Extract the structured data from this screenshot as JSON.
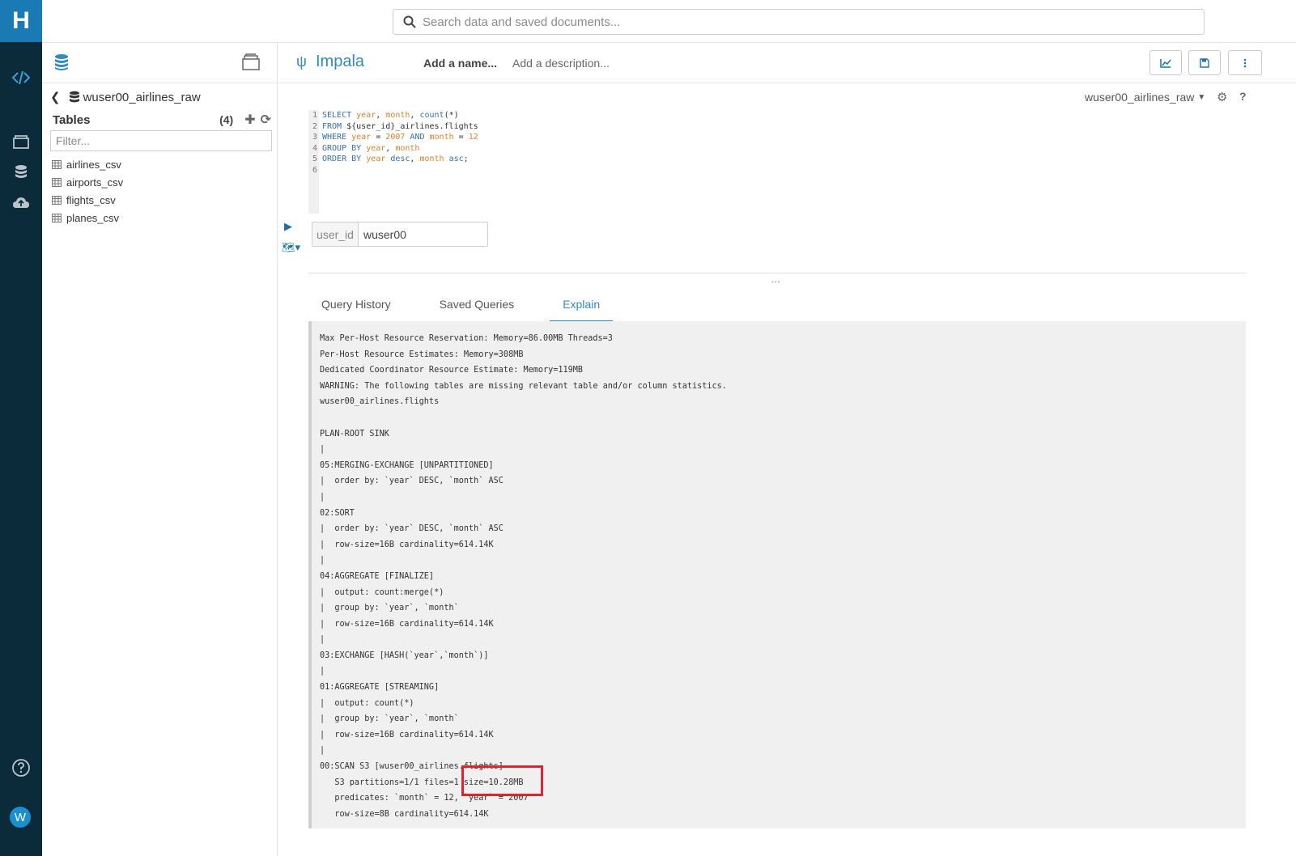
{
  "app": {
    "logo_letter": "H"
  },
  "search": {
    "placeholder": "Search data and saved documents..."
  },
  "assist": {
    "database": "wuser00_airlines_raw",
    "tables_label": "Tables",
    "tables_count": "(4)",
    "filter_placeholder": "Filter...",
    "tables": [
      "airlines_csv",
      "airports_csv",
      "flights_csv",
      "planes_csv"
    ]
  },
  "editor": {
    "engine": "Impala",
    "name_placeholder": "Add a name...",
    "description_placeholder": "Add a description...",
    "database_selector": "wuser00_airlines_raw",
    "line_numbers": [
      "1",
      "2",
      "3",
      "4",
      "5",
      "6"
    ],
    "parameter": {
      "label": "user_id",
      "value": "wuser00"
    }
  },
  "results": {
    "tabs": [
      "Query History",
      "Saved Queries",
      "Explain"
    ],
    "active_tab": "Explain",
    "explain_text": "Max Per-Host Resource Reservation: Memory=86.00MB Threads=3\nPer-Host Resource Estimates: Memory=308MB\nDedicated Coordinator Resource Estimate: Memory=119MB\nWARNING: The following tables are missing relevant table and/or column statistics.\nwuser00_airlines.flights\n\nPLAN-ROOT SINK\n|\n05:MERGING-EXCHANGE [UNPARTITIONED]\n|  order by: `year` DESC, `month` ASC\n|\n02:SORT\n|  order by: `year` DESC, `month` ASC\n|  row-size=16B cardinality=614.14K\n|\n04:AGGREGATE [FINALIZE]\n|  output: count:merge(*)\n|  group by: `year`, `month`\n|  row-size=16B cardinality=614.14K\n|\n03:EXCHANGE [HASH(`year`,`month`)]\n|\n01:AGGREGATE [STREAMING]\n|  output: count(*)\n|  group by: `year`, `month`\n|  row-size=16B cardinality=614.14K\n|\n00:SCAN S3 [wuser00_airlines.flights]\n   S3 partitions=1/1 files=1 size=10.28MB\n   predicates: `month` = 12, `year` = 2007\n   row-size=8B cardinality=614.14K"
  },
  "rail": {
    "avatar_letter": "W"
  },
  "colors": {
    "rail_bg": "#0b2a3a",
    "accent": "#338bb8",
    "highlight_box": "#e0232f"
  }
}
